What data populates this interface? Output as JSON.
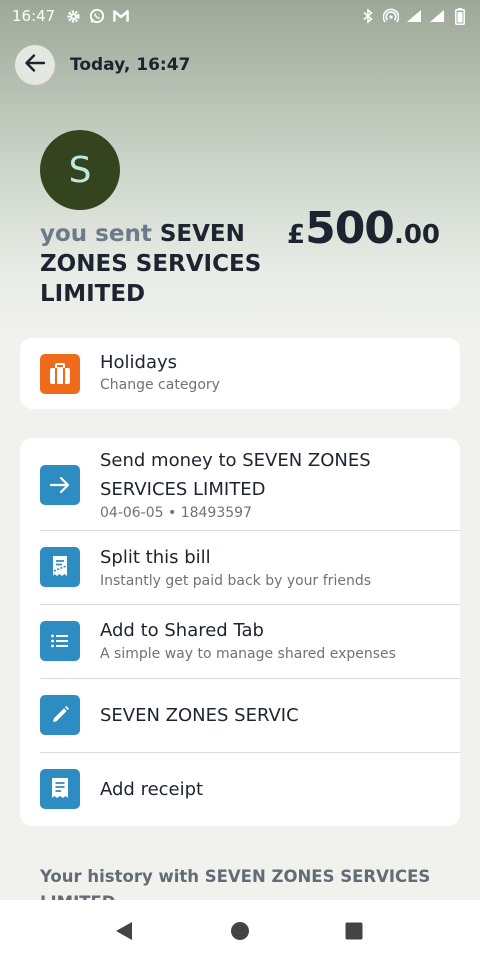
{
  "status_bar": {
    "time": "16:47",
    "left_icons": [
      "gear-icon",
      "whatsapp-icon",
      "gmail-icon"
    ],
    "right_icons": [
      "bluetooth-icon",
      "hotspot-icon",
      "signal-icon",
      "signal-icon",
      "battery-icon"
    ]
  },
  "header": {
    "title": "Today, 16:47"
  },
  "transaction": {
    "avatar_letter": "S",
    "sent_prefix": "you sent",
    "payee": "SEVEN ZONES SERVICES LIMITED",
    "currency": "£",
    "amount_main": "500",
    "amount_cents": ".00"
  },
  "category": {
    "title": "Holidays",
    "subtitle": "Change category",
    "icon": "suitcase-icon",
    "color": "#f06a1c"
  },
  "actions": [
    {
      "title": "Send money to SEVEN ZONES SERVICES LIMITED",
      "subtitle": "04-06-05 • 18493597",
      "icon": "arrow-right-icon"
    },
    {
      "title": "Split this bill",
      "subtitle": "Instantly get paid back by your friends",
      "icon": "split-bill-icon"
    },
    {
      "title": "Add to Shared Tab",
      "subtitle": "A simple way to manage shared expenses",
      "icon": "list-icon"
    },
    {
      "title": "SEVEN ZONES SERVIC",
      "subtitle": "",
      "icon": "pencil-icon"
    },
    {
      "title": "Add receipt",
      "subtitle": "",
      "icon": "receipt-icon"
    }
  ],
  "history": {
    "label": "Your history with SEVEN ZONES SERVICES LIMITED"
  },
  "colors": {
    "accent_blue": "#2d8cc1",
    "avatar_bg": "#33441f",
    "avatar_text": "#bfe8e0",
    "category_orange": "#f06a1c",
    "text_primary": "#1d2430"
  },
  "nav": {
    "icons": [
      "back-triangle-icon",
      "home-circle-icon",
      "recents-square-icon"
    ]
  }
}
